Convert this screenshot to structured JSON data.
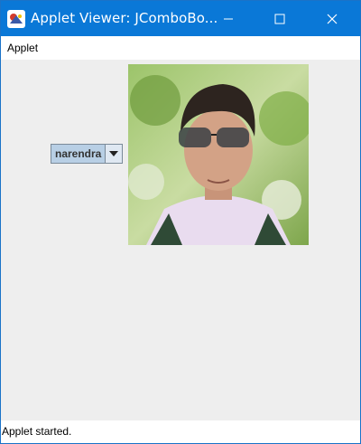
{
  "window": {
    "title": "Applet Viewer: JComboBo...",
    "app_icon": "java-duke-icon",
    "controls": [
      "minimize-icon",
      "maximize-icon",
      "close-icon"
    ]
  },
  "menubar": {
    "items": [
      {
        "label": "Applet"
      }
    ]
  },
  "combo": {
    "selected": "narendra",
    "icon": "chevron-down-icon"
  },
  "photo": {
    "subject": "portrait-photo"
  },
  "status": {
    "text": "Applet started."
  },
  "colors": {
    "titlebar": "#0a78d7",
    "combo_bg": "#b8cfe5",
    "content_bg": "#eeeeee"
  }
}
